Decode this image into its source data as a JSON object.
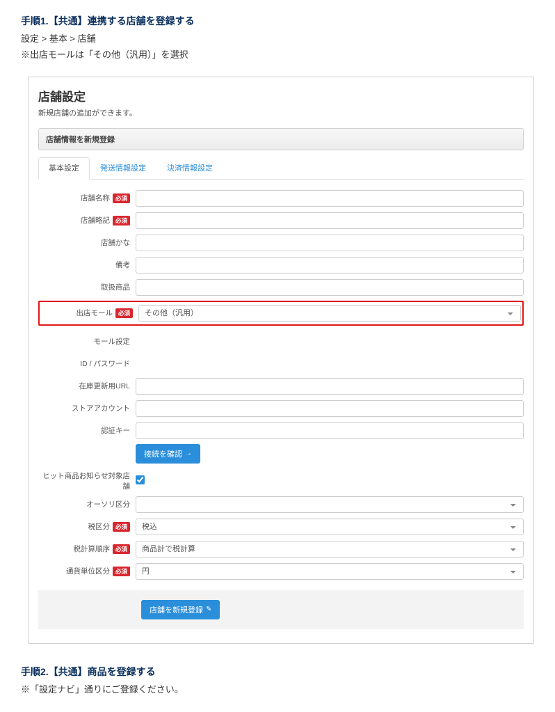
{
  "step1": {
    "title": "手順1.【共通】連携する店舗を登録する",
    "sub1": "設定 > 基本 > 店舗",
    "sub2": "※出店モールは「その他（汎用）」を選択"
  },
  "panel": {
    "title": "店舗設定",
    "desc": "新規店舗の追加ができます。",
    "section": "店舗情報を新規登録"
  },
  "tabs": {
    "t1": "基本設定",
    "t2": "発送情報設定",
    "t3": "決済情報設定"
  },
  "labels": {
    "name": "店舗名称",
    "abbrev": "店舗略記",
    "kana": "店舗かな",
    "note": "備考",
    "products": "取扱商品",
    "mall": "出店モール",
    "mall_settings": "モール設定",
    "idpw": "ID / パスワード",
    "stock_url": "在庫更新用URL",
    "store_account": "ストアアカウント",
    "auth_key": "認証キー",
    "hit_notify": "ヒット商品お知らせ対象店舗",
    "auth_type": "オーソリ区分",
    "tax_type": "税区分",
    "tax_order": "税計算順序",
    "currency_unit": "通貨単位区分"
  },
  "required": "必須",
  "values": {
    "mall": "その他（汎用）",
    "tax_type": "税込",
    "tax_order": "商品計で税計算",
    "currency_unit": "円"
  },
  "buttons": {
    "test_conn": "接続を確認",
    "register": "店舗を新規登録"
  },
  "step2": {
    "title": "手順2.【共通】商品を登録する",
    "sub": "※「設定ナビ」通りにご登録ください。"
  }
}
